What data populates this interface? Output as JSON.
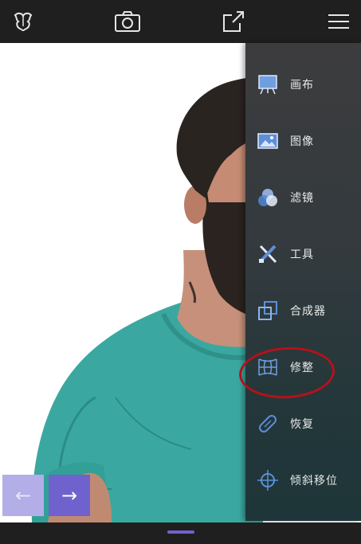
{
  "toolbar": {
    "icons": [
      "logo-icon",
      "camera-icon",
      "share-icon",
      "menu-icon"
    ]
  },
  "menu": {
    "items": [
      {
        "label": "画布",
        "icon": "canvas-icon"
      },
      {
        "label": "图像",
        "icon": "image-icon"
      },
      {
        "label": "滤镜",
        "icon": "filter-icon"
      },
      {
        "label": "工具",
        "icon": "tools-icon"
      },
      {
        "label": "合成器",
        "icon": "compositor-icon"
      },
      {
        "label": "修整",
        "icon": "reshape-icon"
      },
      {
        "label": "恢复",
        "icon": "restore-icon"
      },
      {
        "label": "倾斜移位",
        "icon": "tilt-shift-icon"
      }
    ],
    "highlighted": "修整",
    "highlight_color": "#b4121a"
  },
  "nav": {
    "prev_label": "←",
    "next_label": "→",
    "accent": "#6f62cc"
  },
  "colors": {
    "bar": "#1f1f1f",
    "accent": "#6f62cc",
    "shirt": "#3aa8a0"
  }
}
